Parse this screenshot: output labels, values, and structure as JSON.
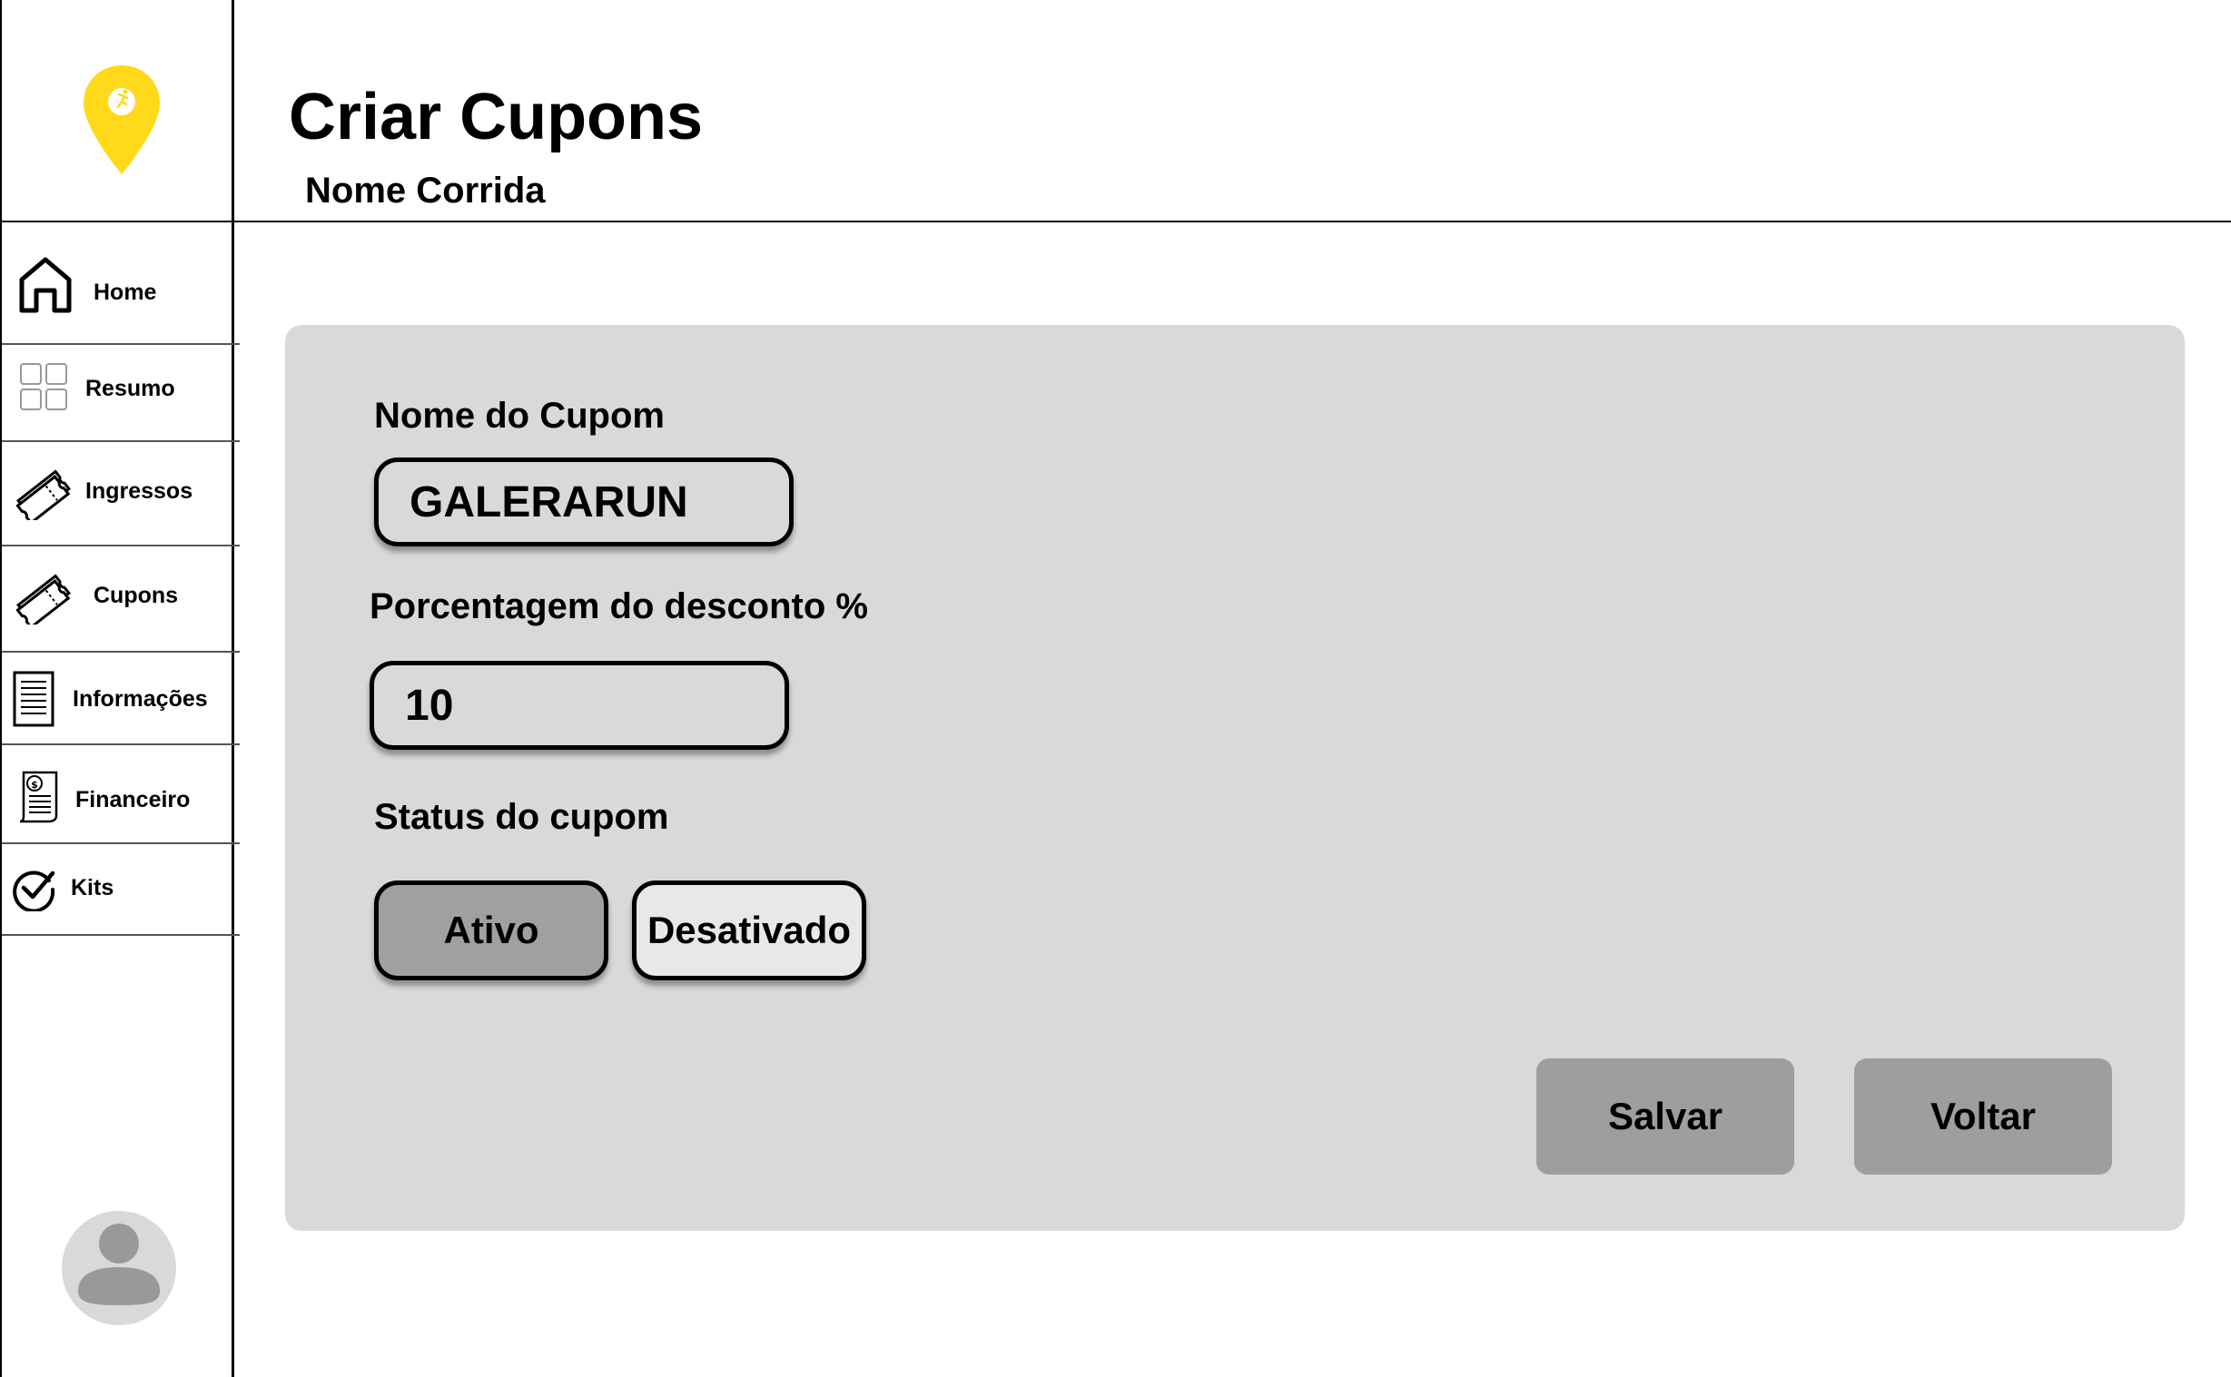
{
  "header": {
    "title": "Criar Cupons",
    "subtitle": "Nome Corrida"
  },
  "brand": {
    "logo_icon": "yellow-location-pin-runner-icon",
    "accent_color": "#FFD91A"
  },
  "sidebar": {
    "items": [
      {
        "label": "Home",
        "icon": "home-icon"
      },
      {
        "label": "Resumo",
        "icon": "grid-icon"
      },
      {
        "label": "Ingressos",
        "icon": "ticket-icon"
      },
      {
        "label": "Cupons",
        "icon": "coupon-ticket-icon"
      },
      {
        "label": "Informações",
        "icon": "document-icon"
      },
      {
        "label": "Financeiro",
        "icon": "receipt-icon"
      },
      {
        "label": "Kits",
        "icon": "check-circle-icon"
      }
    ],
    "avatar_icon": "user-avatar-icon"
  },
  "form": {
    "coupon_name_label": "Nome do Cupom",
    "coupon_name_value": "GALERARUN",
    "discount_label": "Porcentagem do desconto %",
    "discount_value": "10",
    "status_label": "Status do cupom",
    "status_options": [
      "Ativo",
      "Desativado"
    ],
    "status_selected": "Ativo",
    "save_label": "Salvar",
    "back_label": "Voltar"
  },
  "colors": {
    "panel_bg": "#D9D9D9",
    "button_gray": "#9E9E9E",
    "selected_status": "#A0A0A0"
  }
}
